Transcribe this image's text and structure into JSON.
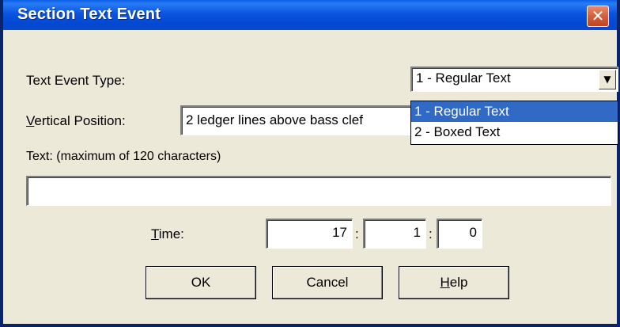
{
  "window": {
    "title": "Section Text Event",
    "close_glyph": "✕"
  },
  "labels": {
    "text_event_type": "Text Event Type:",
    "vertical_position_mnemonic": "V",
    "vertical_position_rest": "ertical Position:",
    "text_hint": "Text:  (maximum of 120 characters)",
    "time_mnemonic": "T",
    "time_rest": "ime:"
  },
  "text_event_type": {
    "selected": "1 - Regular Text",
    "options": [
      "1 - Regular Text",
      "2 - Boxed Text"
    ],
    "highlighted_index": 0
  },
  "vertical_position": {
    "value": "2 ledger lines above bass clef"
  },
  "text_field": {
    "value": ""
  },
  "time": {
    "bar": "17",
    "beat": "1",
    "tick": "0",
    "separator": ":"
  },
  "buttons": {
    "ok": "OK",
    "cancel": "Cancel",
    "help_mnemonic": "H",
    "help_rest": "elp"
  },
  "icons": {
    "dropdown_arrow": "▼"
  },
  "colors": {
    "titlebar": "#0A54E0",
    "dialog_bg": "#ECE9D8",
    "close_button": "#D35F3C",
    "selection": "#316AC5"
  }
}
